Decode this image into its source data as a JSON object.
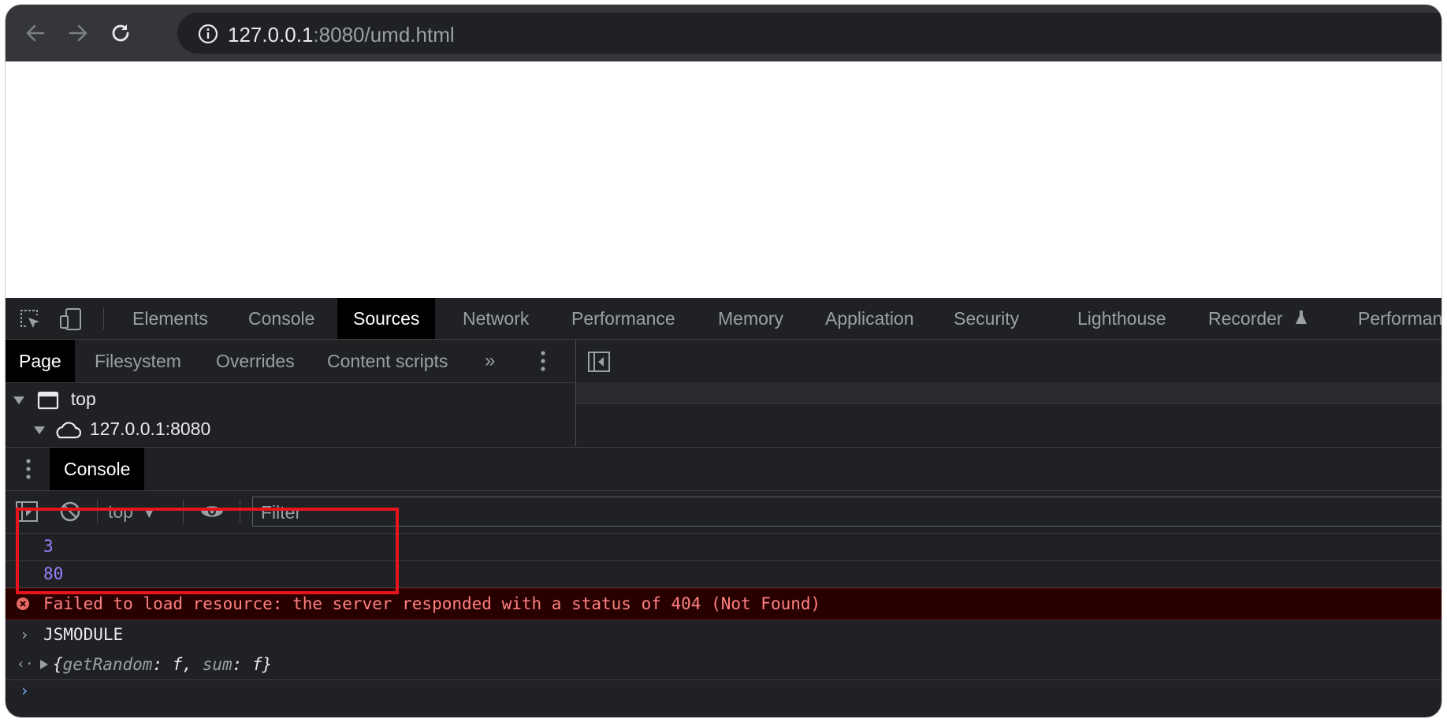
{
  "browser": {
    "url_host": "127.0.0.1",
    "url_rest": ":8080/umd.html"
  },
  "devtools": {
    "main_tabs": [
      "Elements",
      "Console",
      "Sources",
      "Network",
      "Performance",
      "Memory",
      "Application",
      "Security",
      "Lighthouse",
      "Recorder",
      "Performan"
    ],
    "active_main_tab": "Sources",
    "sources_nav_tabs": [
      "Page",
      "Filesystem",
      "Overrides",
      "Content scripts"
    ],
    "active_nav_tab": "Page",
    "tree": {
      "root": "top",
      "child": "127.0.0.1:8080"
    },
    "drawer_tab": "Console",
    "console_toolbar": {
      "context": "top",
      "filter_placeholder": "Filter"
    },
    "messages": [
      {
        "type": "number",
        "text": "3"
      },
      {
        "type": "number",
        "text": "80"
      },
      {
        "type": "error",
        "text": "Failed to load resource: the server responded with a status of 404 (Not Found)"
      },
      {
        "type": "log",
        "text": "JSMODULE"
      },
      {
        "type": "result",
        "object": {
          "open": "{",
          "key1": "getRandom",
          "sep": ": ",
          "val1": "f",
          "comma": ", ",
          "key2": "sum",
          "val2": "f",
          "close": "}"
        }
      }
    ]
  },
  "colors": {
    "highlight": "#e8141b",
    "error_text": "#ff8080",
    "number_text": "#9980ff"
  }
}
